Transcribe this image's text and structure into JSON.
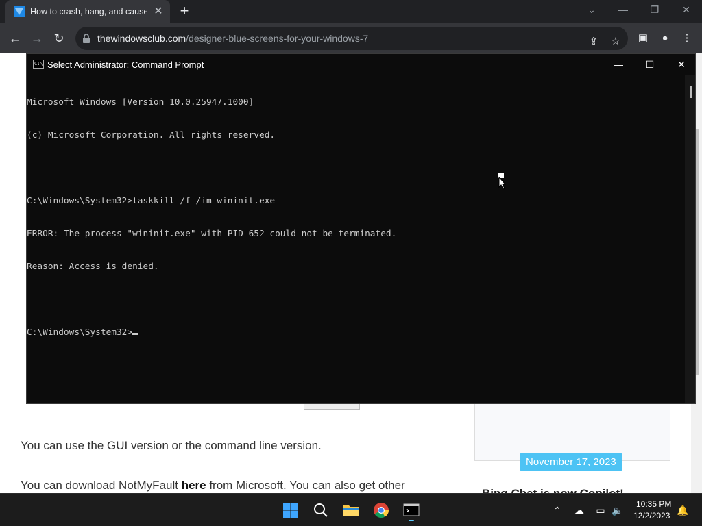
{
  "browser": {
    "tab_title": "How to crash, hang, and cause Bl",
    "url_host": "thewindowsclub.com",
    "url_path": "/designer-blue-screens-for-your-windows-7"
  },
  "page": {
    "para1": "You can use the GUI version or the command line version.",
    "para2_before": "You can download NotMyFault ",
    "para2_link": "here",
    "para2_after": " from Microsoft. You can also get other",
    "date_badge": "November 17, 2023",
    "side_heading": "Bing Chat is now Copilot!"
  },
  "cmd": {
    "title": "Select Administrator: Command Prompt",
    "lines": [
      "Microsoft Windows [Version 10.0.25947.1000]",
      "(c) Microsoft Corporation. All rights reserved.",
      "",
      "C:\\Windows\\System32>taskkill /f /im wininit.exe",
      "ERROR: The process \"wininit.exe\" with PID 652 could not be terminated.",
      "Reason: Access is denied.",
      "",
      "C:\\Windows\\System32>"
    ]
  },
  "taskbar": {
    "time": "10:35 PM",
    "date": "12/2/2023"
  },
  "colors": {
    "accent_badge": "#4dc3f4",
    "console_bg": "#0c0c0c",
    "console_text": "#cccccc"
  }
}
